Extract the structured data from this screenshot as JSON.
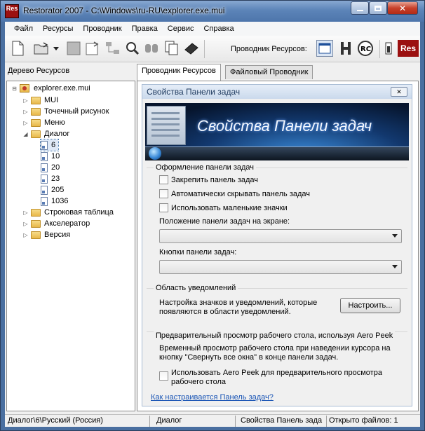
{
  "window": {
    "title": "Restorator 2007 - C:\\Windows\\ru-RU\\explorer.exe.mui",
    "app_icon_text": "Res"
  },
  "menu": [
    "Файл",
    "Ресурсы",
    "Проводник",
    "Правка",
    "Сервис",
    "Справка"
  ],
  "toolbar": {
    "explorer_label": "Проводник Ресурсов:",
    "res_logo": "Res"
  },
  "left": {
    "header": "Дерево Ресурсов"
  },
  "tree": {
    "root": "explorer.exe.mui",
    "items": [
      "MUI",
      "Точечный рисунок",
      "Меню",
      "Диалог",
      "6",
      "10",
      "20",
      "23",
      "205",
      "1036",
      "Строковая таблица",
      "Акселератор",
      "Версия"
    ]
  },
  "tabs": [
    "Проводник Ресурсов",
    "Файловый Проводник"
  ],
  "dialog": {
    "title": "Свойства Панели задач",
    "banner": "Свойства Панели задач",
    "grp1": "Оформление панели задач",
    "chk1": "Закрепить панель задач",
    "chk2": "Автоматически скрывать панель задач",
    "chk3": "Использовать маленькие значки",
    "pos_label": "Положение панели задач на экране:",
    "btns_label": "Кнопки панели задач:",
    "grp2": "Область уведомлений",
    "notif_text1": "Настройка значков и уведомлений, которые",
    "notif_text2": "появляются в области уведомлений.",
    "configure": "Настроить...",
    "grp3": "Предварительный просмотр рабочего стола, используя Aero Peek",
    "peek_text1": "Временный просмотр рабочего стола при наведении курсора на",
    "peek_text2": "кнопку \"Свернуть все окна\" в конце панели задач.",
    "peek_chk1": "Использовать Aero Peek для предварительного просмотра",
    "peek_chk2": "рабочего стола",
    "link": "Как настраивается Панель задач?"
  },
  "status": {
    "path": "Диалог\\6\\Русский (Россия)",
    "type": "Диалог",
    "name": "Свойства Панель зада",
    "files": "Открыто файлов: 1"
  }
}
